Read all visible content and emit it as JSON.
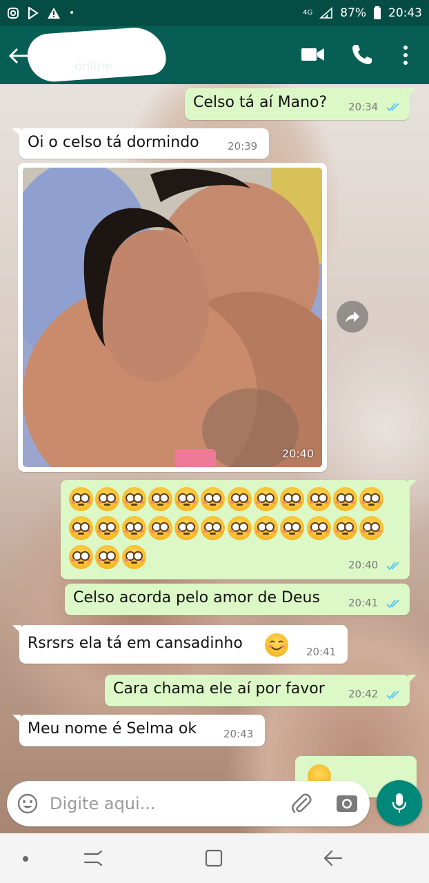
{
  "status_bar": {
    "network": "4G",
    "battery": "87%",
    "time": "20:43"
  },
  "header": {
    "contact_status": "online"
  },
  "messages": {
    "m1": {
      "text": "Celso tá aí Mano?",
      "time": "20:34"
    },
    "m2": {
      "text": "Oi o celso tá dormindo",
      "time": "20:39"
    },
    "m3": {
      "time": "20:40"
    },
    "m4": {
      "emoji_count": 27,
      "time": "20:40"
    },
    "m5": {
      "text": "Celso acorda pelo amor de Deus",
      "time": "20:41"
    },
    "m6": {
      "text": "Rsrsrs ela tá em cansadinho",
      "time": "20:41"
    },
    "m7": {
      "text": "Cara chama ele aí por favor",
      "time": "20:42"
    },
    "m8": {
      "text": "Meu nome é Selma ok",
      "time": "20:43"
    }
  },
  "input": {
    "placeholder": "Digite aqui..."
  },
  "colors": {
    "header": "#075e54",
    "status_bar": "#054d44",
    "outgoing_bubble": "#dcf8c6",
    "incoming_bubble": "#ffffff",
    "read_ticks": "#4fc3f7",
    "mic_button": "#00897b"
  },
  "icons": [
    "back-arrow-icon",
    "video-call-icon",
    "phone-icon",
    "more-vert-icon",
    "forward-icon",
    "emoji-icon",
    "attach-icon",
    "camera-icon",
    "mic-icon"
  ]
}
